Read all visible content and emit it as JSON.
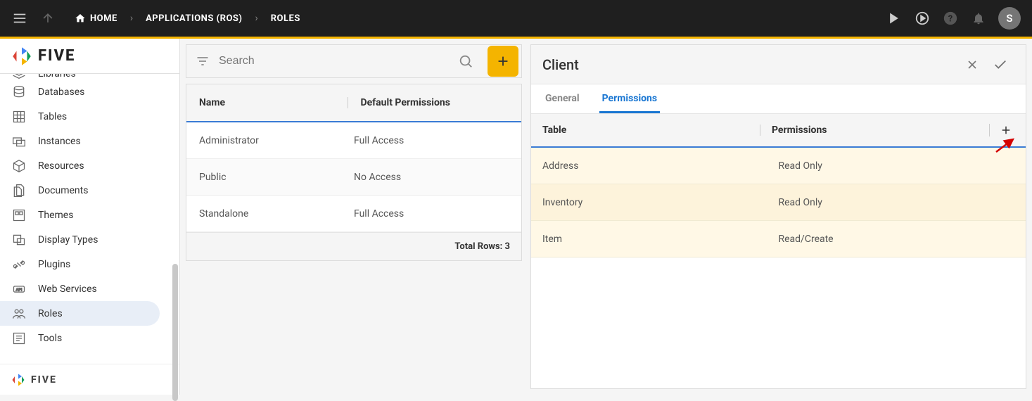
{
  "topbar": {
    "breadcrumbs": [
      {
        "label": "HOME",
        "icon": "home"
      },
      {
        "label": "APPLICATIONS (ROS)"
      },
      {
        "label": "ROLES"
      }
    ],
    "avatar_initial": "S"
  },
  "brand": {
    "name": "FIVE"
  },
  "sidebar": {
    "items": [
      {
        "label": "Libraries",
        "icon": "layers",
        "cut": true
      },
      {
        "label": "Databases",
        "icon": "database"
      },
      {
        "label": "Tables",
        "icon": "grid"
      },
      {
        "label": "Instances",
        "icon": "monitors"
      },
      {
        "label": "Resources",
        "icon": "cube"
      },
      {
        "label": "Documents",
        "icon": "docs"
      },
      {
        "label": "Themes",
        "icon": "swatch"
      },
      {
        "label": "Display Types",
        "icon": "display"
      },
      {
        "label": "Plugins",
        "icon": "plug"
      },
      {
        "label": "Web Services",
        "icon": "api"
      },
      {
        "label": "Roles",
        "icon": "roles",
        "active": true
      },
      {
        "label": "Tools",
        "icon": "tools"
      }
    ]
  },
  "roles_list": {
    "search_placeholder": "Search",
    "columns": [
      "Name",
      "Default Permissions"
    ],
    "rows": [
      {
        "name": "Administrator",
        "perm": "Full Access"
      },
      {
        "name": "Public",
        "perm": "No Access"
      },
      {
        "name": "Standalone",
        "perm": "Full Access"
      }
    ],
    "footer": "Total Rows: 3"
  },
  "detail": {
    "title": "Client",
    "tabs": [
      {
        "label": "General",
        "active": false
      },
      {
        "label": "Permissions",
        "active": true
      }
    ],
    "perm_columns": [
      "Table",
      "Permissions"
    ],
    "perm_rows": [
      {
        "table": "Address",
        "perm": "Read Only"
      },
      {
        "table": "Inventory",
        "perm": "Read Only"
      },
      {
        "table": "Item",
        "perm": "Read/Create"
      }
    ]
  }
}
